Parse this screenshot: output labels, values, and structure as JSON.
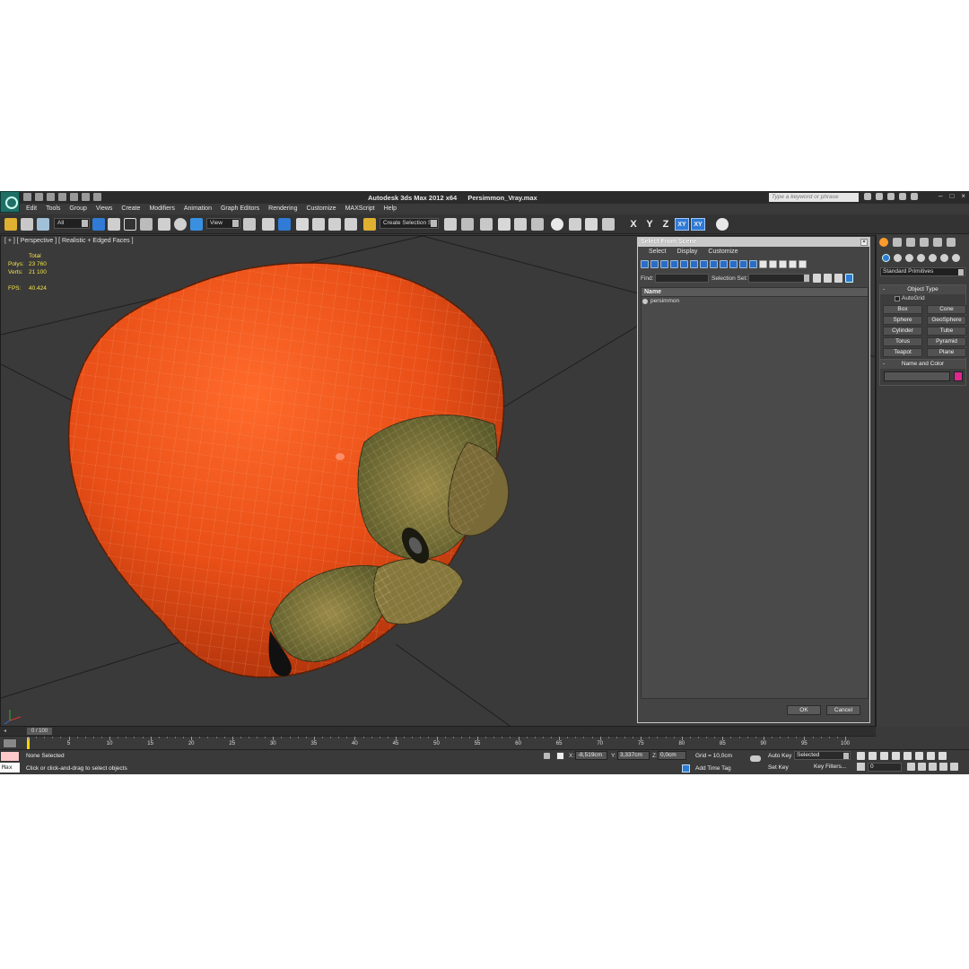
{
  "window": {
    "app_title": "Autodesk 3ds Max  2012 x64",
    "file_name": "Persimmon_Vray.max",
    "search_placeholder": "Type a keyword or phrase"
  },
  "menubar": [
    "Edit",
    "Tools",
    "Group",
    "Views",
    "Create",
    "Modifiers",
    "Animation",
    "Graph Editors",
    "Rendering",
    "Customize",
    "MAXScript",
    "Help"
  ],
  "toolbar": {
    "selection_filter": "All",
    "reference_coord": "View",
    "named_selection_set": "Create Selection Se",
    "axis_labels": [
      "X",
      "Y",
      "Z",
      "XY",
      "XY"
    ]
  },
  "viewport": {
    "label": "[ + ] [ Perspective ] [ Realistic + Edged Faces ]",
    "stats": {
      "header": "Total",
      "polys_label": "Polys:",
      "polys_value": "23 760",
      "verts_label": "Verts:",
      "verts_value": "21 100",
      "fps_label": "FPS:",
      "fps_value": "40.424"
    },
    "colors": {
      "fruit": "#e8521a",
      "wire": "#f0a27a",
      "calyx": "#7a7a3a"
    }
  },
  "dialog": {
    "title": "Select From Scene",
    "menu": [
      "Select",
      "Display",
      "Customize"
    ],
    "find_label": "Find:",
    "selection_set_label": "Selection Set:",
    "column_name": "Name",
    "objects": [
      "persimmon"
    ],
    "ok_label": "OK",
    "cancel_label": "Cancel"
  },
  "command_panel": {
    "category": "Standard Primitives",
    "object_type_title": "Object Type",
    "autogrid_label": "AutoGrid",
    "object_buttons": [
      "Box",
      "Cone",
      "Sphere",
      "GeoSphere",
      "Cylinder",
      "Tube",
      "Torus",
      "Pyramid",
      "Teapot",
      "Plane"
    ],
    "name_color_title": "Name and Color",
    "swatch_color": "#e0278f"
  },
  "timeline": {
    "frame_display": "0 / 100",
    "ticks": [
      0,
      5,
      10,
      15,
      20,
      25,
      30,
      35,
      40,
      45,
      50,
      55,
      60,
      65,
      70,
      75,
      80,
      85,
      90,
      95,
      100
    ]
  },
  "statusbar": {
    "maxscript_label": "Max",
    "selection_status": "None Selected",
    "prompt": "Click or click-and-drag to select objects",
    "x_label": "X:",
    "x_value": "-8,519cm",
    "y_label": "Y:",
    "y_value": "3,337cm",
    "z_label": "Z:",
    "z_value": "0,0cm",
    "grid": "Grid = 10,0cm",
    "add_time_tag": "Add Time Tag",
    "auto_key": "Auto Key",
    "set_key": "Set Key",
    "key_mode": "Selected",
    "key_filters": "Key Filters...",
    "current_frame": "0"
  }
}
